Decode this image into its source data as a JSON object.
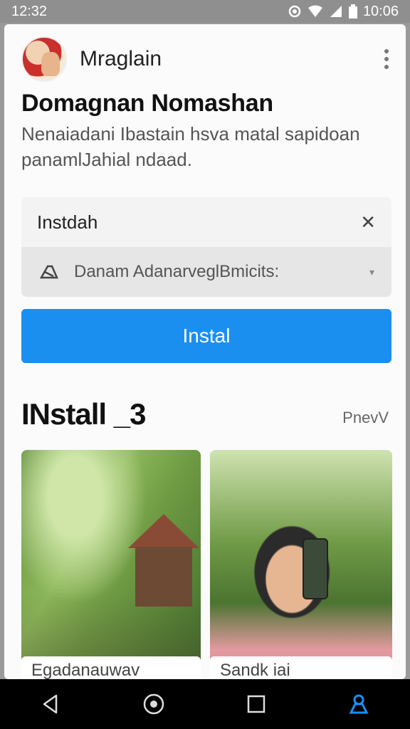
{
  "status": {
    "time_left": "12:32",
    "time_right": "10:06"
  },
  "app": {
    "name": "Mraglain",
    "title": "Domagnan Nomashan",
    "description": "Nenaiadani Ibastain hsva matal sapidoan panamlJahial ndaad."
  },
  "panel": {
    "title": "Instdah",
    "subtitle": "Danam AdanarveglBmicits:"
  },
  "install_button": {
    "label": "Instal"
  },
  "section": {
    "title": "INstall _3",
    "link": "PnevV"
  },
  "thumbnails": [
    {
      "label": "Egadanauwav"
    },
    {
      "label": "Sandk         iai"
    }
  ],
  "colors": {
    "accent": "#1b8ff0",
    "nav_active": "#1b8ff0"
  }
}
